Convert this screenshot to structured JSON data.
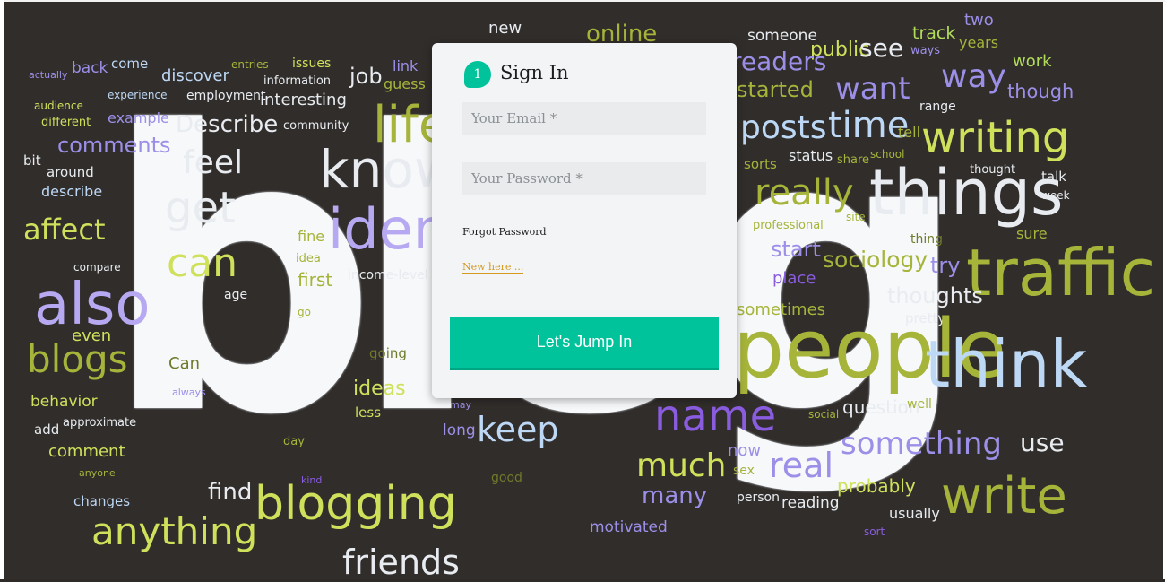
{
  "background": {
    "words": [
      {
        "text": "blog",
        "color": "#f6f8fa"
      },
      {
        "text": "new",
        "color": "#e8ecf0"
      },
      {
        "text": "online",
        "color": "#a6b43a"
      },
      {
        "text": "someone",
        "color": "#e8ecf0"
      },
      {
        "text": "two",
        "color": "#9c8fe8"
      },
      {
        "text": "track",
        "color": "#b2dd5a"
      },
      {
        "text": "years",
        "color": "#a6b43a"
      },
      {
        "text": "public",
        "color": "#cfe05b"
      },
      {
        "text": "see",
        "color": "#e8ecf0"
      },
      {
        "text": "ways",
        "color": "#9c8fe8"
      },
      {
        "text": "work",
        "color": "#b2dd5a"
      },
      {
        "text": "readers",
        "color": "#9c8fe8"
      },
      {
        "text": "started",
        "color": "#a6b43a"
      },
      {
        "text": "want",
        "color": "#9c8fe8"
      },
      {
        "text": "way",
        "color": "#9c8fe8"
      },
      {
        "text": "though",
        "color": "#9c8fe8"
      },
      {
        "text": "range",
        "color": "#e8ecf0"
      },
      {
        "text": "posts",
        "color": "#bdd8f5"
      },
      {
        "text": "time",
        "color": "#bdd8f5"
      },
      {
        "text": "tell",
        "color": "#a6b43a"
      },
      {
        "text": "writing",
        "color": "#cfe05b"
      },
      {
        "text": "sorts",
        "color": "#a6b43a"
      },
      {
        "text": "status",
        "color": "#e8ecf0"
      },
      {
        "text": "share",
        "color": "#a6b43a"
      },
      {
        "text": "school",
        "color": "#a6b43a"
      },
      {
        "text": "thought",
        "color": "#e8ecf0"
      },
      {
        "text": "talk",
        "color": "#e8ecf0"
      },
      {
        "text": "week",
        "color": "#e8ecf0"
      },
      {
        "text": "really",
        "color": "#a6b43a"
      },
      {
        "text": "things",
        "color": "#e8ecf0"
      },
      {
        "text": "professional",
        "color": "#a6b43a"
      },
      {
        "text": "site",
        "color": "#a6b43a"
      },
      {
        "text": "thing",
        "color": "#6f7a2a"
      },
      {
        "text": "sure",
        "color": "#a6b43a"
      },
      {
        "text": "start",
        "color": "#9c8fe8"
      },
      {
        "text": "sociology",
        "color": "#a6b43a"
      },
      {
        "text": "try",
        "color": "#9c8fe8"
      },
      {
        "text": "traffic",
        "color": "#a6b43a"
      },
      {
        "text": "place",
        "color": "#8a5ce0"
      },
      {
        "text": "thoughts",
        "color": "#e8ecf0"
      },
      {
        "text": "sometimes",
        "color": "#a6b43a"
      },
      {
        "text": "pretty",
        "color": "#e8ecf0"
      },
      {
        "text": "people",
        "color": "#a6b43a"
      },
      {
        "text": "think",
        "color": "#bdd8f5"
      },
      {
        "text": "name",
        "color": "#8a5ce0"
      },
      {
        "text": "social",
        "color": "#a6b43a"
      },
      {
        "text": "question",
        "color": "#e8ecf0"
      },
      {
        "text": "well",
        "color": "#a6b43a"
      },
      {
        "text": "something",
        "color": "#9c8fe8"
      },
      {
        "text": "use",
        "color": "#e8ecf0"
      },
      {
        "text": "now",
        "color": "#9c8fe8"
      },
      {
        "text": "much",
        "color": "#cfe05b"
      },
      {
        "text": "real",
        "color": "#9c8fe8"
      },
      {
        "text": "sex",
        "color": "#a6b43a"
      },
      {
        "text": "probably",
        "color": "#cfe05b"
      },
      {
        "text": "many",
        "color": "#9c8fe8"
      },
      {
        "text": "person",
        "color": "#e8ecf0"
      },
      {
        "text": "reading",
        "color": "#e8ecf0"
      },
      {
        "text": "write",
        "color": "#a6b43a"
      },
      {
        "text": "usually",
        "color": "#e8ecf0"
      },
      {
        "text": "motivated",
        "color": "#9c8fe8"
      },
      {
        "text": "sort",
        "color": "#8a5ce0"
      },
      {
        "text": "actually",
        "color": "#9c8fe8"
      },
      {
        "text": "back",
        "color": "#9c8fe8"
      },
      {
        "text": "come",
        "color": "#bdd8f5"
      },
      {
        "text": "discover",
        "color": "#bdd8f5"
      },
      {
        "text": "entries",
        "color": "#a6b43a"
      },
      {
        "text": "issues",
        "color": "#cfe05b"
      },
      {
        "text": "link",
        "color": "#9c8fe8"
      },
      {
        "text": "information",
        "color": "#e8ecf0"
      },
      {
        "text": "job",
        "color": "#e8ecf0"
      },
      {
        "text": "guess",
        "color": "#a6b43a"
      },
      {
        "text": "experience",
        "color": "#bdd8f5"
      },
      {
        "text": "employment",
        "color": "#e8ecf0"
      },
      {
        "text": "interesting",
        "color": "#e8ecf0"
      },
      {
        "text": "audience",
        "color": "#cfe05b"
      },
      {
        "text": "example",
        "color": "#9c8fe8"
      },
      {
        "text": "different",
        "color": "#cfe05b"
      },
      {
        "text": "Describe",
        "color": "#e8ecf0"
      },
      {
        "text": "community",
        "color": "#e8ecf0"
      },
      {
        "text": "life",
        "color": "#a6b43a"
      },
      {
        "text": "comments",
        "color": "#9c8fe8"
      },
      {
        "text": "bit",
        "color": "#e8ecf0"
      },
      {
        "text": "feel",
        "color": "#e8ecf0"
      },
      {
        "text": "around",
        "color": "#e8ecf0"
      },
      {
        "text": "know",
        "color": "#e8ecf0"
      },
      {
        "text": "describe",
        "color": "#bdd8f5"
      },
      {
        "text": "get",
        "color": "#e8ecf0"
      },
      {
        "text": "identity",
        "color": "#b7a8f2"
      },
      {
        "text": "affect",
        "color": "#cfe05b"
      },
      {
        "text": "fine",
        "color": "#a6b43a"
      },
      {
        "text": "idea",
        "color": "#a6b43a"
      },
      {
        "text": "compare",
        "color": "#e8ecf0"
      },
      {
        "text": "can",
        "color": "#cfe05b"
      },
      {
        "text": "first",
        "color": "#a6b43a"
      },
      {
        "text": "income-level",
        "color": "#e8ecf0"
      },
      {
        "text": "also",
        "color": "#b7a8f2"
      },
      {
        "text": "age",
        "color": "#e8ecf0"
      },
      {
        "text": "go",
        "color": "#a6b43a"
      },
      {
        "text": "even",
        "color": "#cfe05b"
      },
      {
        "text": "blogs",
        "color": "#a6b43a"
      },
      {
        "text": "going",
        "color": "#6f7a2a"
      },
      {
        "text": "Can",
        "color": "#6f7a2a"
      },
      {
        "text": "ideas",
        "color": "#cfe05b"
      },
      {
        "text": "always",
        "color": "#9c8fe8"
      },
      {
        "text": "less",
        "color": "#cfe05b"
      },
      {
        "text": "behavior",
        "color": "#cfe05b"
      },
      {
        "text": "add",
        "color": "#e8ecf0"
      },
      {
        "text": "approximate",
        "color": "#e8ecf0"
      },
      {
        "text": "may",
        "color": "#9c8fe8"
      },
      {
        "text": "long",
        "color": "#9c8fe8"
      },
      {
        "text": "keep",
        "color": "#bdd8f5"
      },
      {
        "text": "day",
        "color": "#a6b43a"
      },
      {
        "text": "comment",
        "color": "#cfe05b"
      },
      {
        "text": "anyone",
        "color": "#a6b43a"
      },
      {
        "text": "kind",
        "color": "#8a5ce0"
      },
      {
        "text": "good",
        "color": "#6f7a2a"
      },
      {
        "text": "changes",
        "color": "#bdd8f5"
      },
      {
        "text": "find",
        "color": "#e8ecf0"
      },
      {
        "text": "blogging",
        "color": "#cfe05b"
      },
      {
        "text": "anything",
        "color": "#cfe05b"
      },
      {
        "text": "friends",
        "color": "#e8ecf0"
      }
    ]
  },
  "signin": {
    "step": "1",
    "title": "Sign In",
    "email_placeholder": "Your Email *",
    "password_placeholder": "Your Password *",
    "forgot_label": "Forgot Password",
    "new_label": "New here ...",
    "submit_label": "Let's Jump In"
  }
}
